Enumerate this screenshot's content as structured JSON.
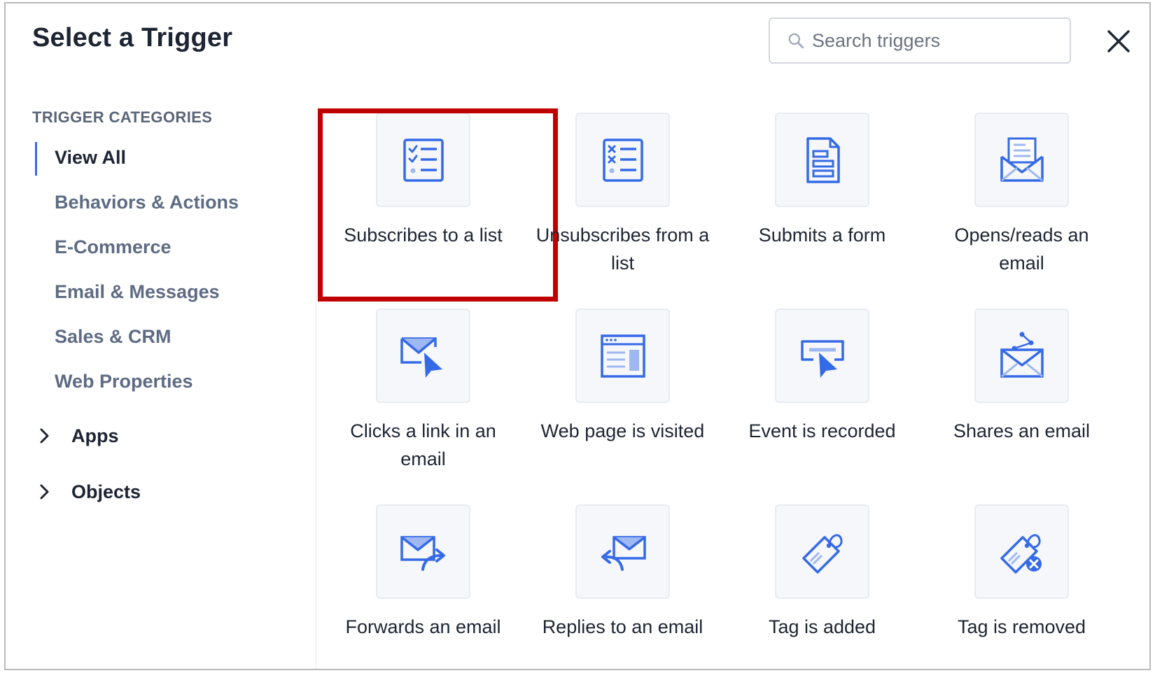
{
  "dialog": {
    "title": "Select a Trigger",
    "search": {
      "placeholder": "Search triggers",
      "value": ""
    }
  },
  "sidebar": {
    "heading": "TRIGGER CATEGORIES",
    "categories": [
      {
        "label": "View All",
        "active": true
      },
      {
        "label": "Behaviors & Actions"
      },
      {
        "label": "E-Commerce"
      },
      {
        "label": "Email & Messages"
      },
      {
        "label": "Sales & CRM"
      },
      {
        "label": "Web Properties"
      }
    ],
    "groups": [
      {
        "label": "Apps",
        "icon": "chevron-right-icon"
      },
      {
        "label": "Objects",
        "icon": "chevron-right-icon"
      }
    ]
  },
  "triggers": [
    {
      "label": "Subscribes to a list",
      "icon": "checklist-icon",
      "highlighted": true
    },
    {
      "label": "Unsubscribes from a list",
      "icon": "x-list-icon"
    },
    {
      "label": "Submits a form",
      "icon": "form-document-icon"
    },
    {
      "label": "Opens/reads an email",
      "icon": "open-envelope-icon"
    },
    {
      "label": "Clicks a link in an email",
      "icon": "envelope-cursor-icon"
    },
    {
      "label": "Web page is visited",
      "icon": "web-page-icon"
    },
    {
      "label": "Event is recorded",
      "icon": "event-cursor-icon"
    },
    {
      "label": "Shares an email",
      "icon": "share-envelope-icon"
    },
    {
      "label": "Forwards an email",
      "icon": "forward-envelope-icon"
    },
    {
      "label": "Replies to an email",
      "icon": "reply-envelope-icon"
    },
    {
      "label": "Tag is added",
      "icon": "tag-icon"
    },
    {
      "label": "Tag is removed",
      "icon": "tag-remove-icon"
    }
  ],
  "colors": {
    "accent": "#356ae6",
    "highlight": "#c00000",
    "tile_bg": "#f5f7fb"
  }
}
